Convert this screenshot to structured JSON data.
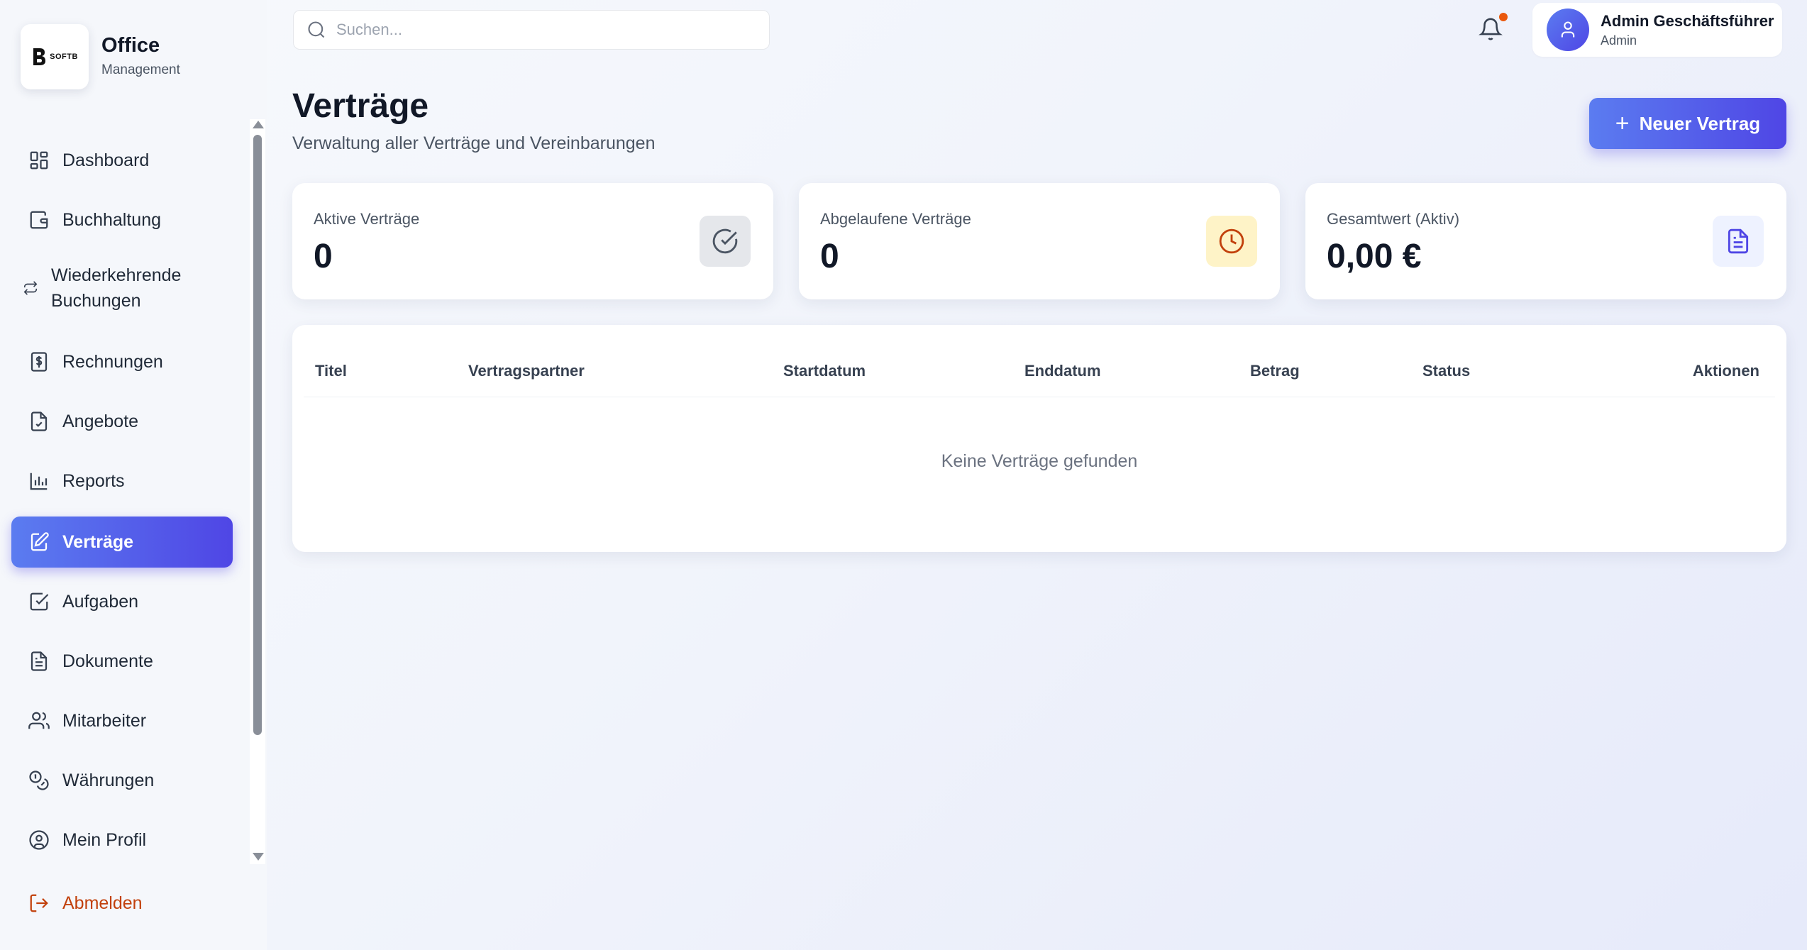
{
  "brand": {
    "logo_text": "SOFTB",
    "title": "Office",
    "subtitle": "Management"
  },
  "search": {
    "placeholder": "Suchen..."
  },
  "user": {
    "name": "Admin Geschäftsführer",
    "role": "Admin"
  },
  "sidebar": {
    "items": [
      {
        "label": "Dashboard",
        "icon": "dashboard-icon"
      },
      {
        "label": "Buchhaltung",
        "icon": "wallet-icon"
      },
      {
        "label": "Wiederkehrende Buchungen",
        "icon": "repeat-icon"
      },
      {
        "label": "Rechnungen",
        "icon": "receipt-icon"
      },
      {
        "label": "Angebote",
        "icon": "file-check-icon"
      },
      {
        "label": "Reports",
        "icon": "bar-chart-icon"
      },
      {
        "label": "Verträge",
        "icon": "edit-file-icon",
        "active": true
      },
      {
        "label": "Aufgaben",
        "icon": "checkbox-icon"
      },
      {
        "label": "Dokumente",
        "icon": "document-icon"
      },
      {
        "label": "Mitarbeiter",
        "icon": "users-icon"
      },
      {
        "label": "Währungen",
        "icon": "coins-icon"
      },
      {
        "label": "Mein Profil",
        "icon": "user-circle-icon"
      }
    ],
    "logout_label": "Abmelden"
  },
  "page": {
    "title": "Verträge",
    "subtitle": "Verwaltung aller Verträge und Vereinbarungen",
    "new_button_label": "Neuer Vertrag"
  },
  "stats": [
    {
      "label": "Aktive Verträge",
      "value": "0",
      "icon": "check-circle-icon",
      "icon_bg": "#e5e7eb",
      "icon_color": "#4b5563"
    },
    {
      "label": "Abgelaufene Verträge",
      "value": "0",
      "icon": "clock-icon",
      "icon_bg": "#fef3c7",
      "icon_color": "#c2410c"
    },
    {
      "label": "Gesamtwert (Aktiv)",
      "value": "0,00 €",
      "icon": "document-icon",
      "icon_bg": "#eef2ff",
      "icon_color": "#4f46e5"
    }
  ],
  "table": {
    "columns": [
      "Titel",
      "Vertragspartner",
      "Startdatum",
      "Enddatum",
      "Betrag",
      "Status",
      "Aktionen"
    ],
    "empty_text": "Keine Verträge gefunden"
  },
  "colors": {
    "accent": "#4f46e5",
    "accent_light": "#5b7cf0",
    "logout": "#c2410c",
    "notification_dot": "#ea580c"
  }
}
